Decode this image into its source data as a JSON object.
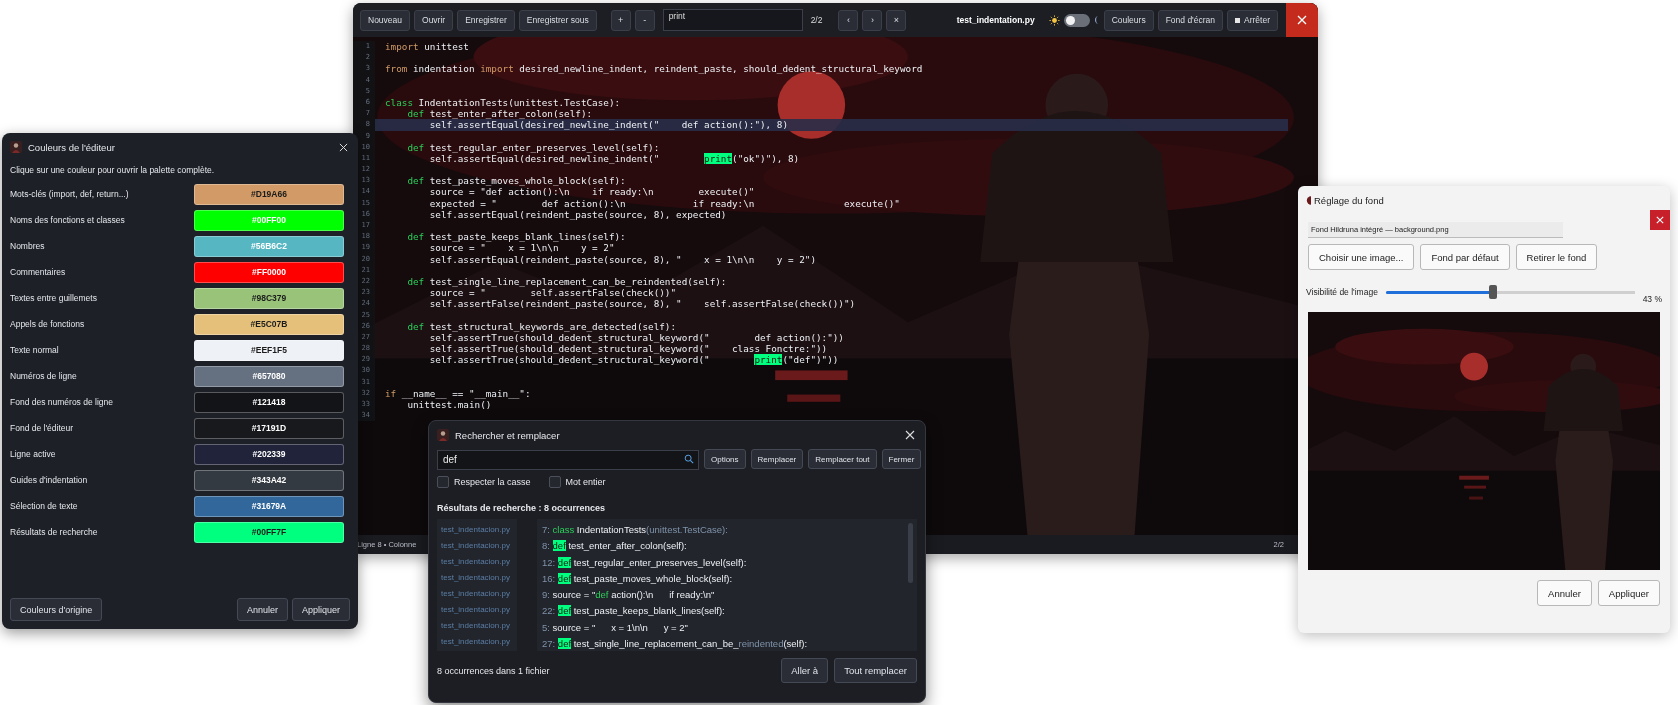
{
  "editor": {
    "toolbar": {
      "file_buttons": [
        "Nouveau",
        "Ouvrir",
        "Enregistrer",
        "Enregistrer sous"
      ],
      "zoom_buttons": [
        "+",
        "-"
      ],
      "search": {
        "value": "print"
      },
      "match_count": "2/2",
      "nav_buttons": [
        "‹",
        "›",
        "×"
      ],
      "filename": "test_indentation.py",
      "theme_toggle": {
        "on": false
      },
      "buttons": [
        {
          "label": "Couleurs",
          "kind": "plain"
        },
        {
          "label": "Fond d'écran",
          "kind": "plain"
        },
        {
          "label": "Arrêter",
          "kind": "stop"
        }
      ]
    },
    "code_lines": [
      {
        "number": "1",
        "active": false,
        "segments": [
          {
            "kind": "keyword",
            "text": "import"
          },
          {
            "kind": "plain",
            "text": " unittest"
          }
        ]
      },
      {
        "number": "2",
        "active": false
      },
      {
        "number": "3",
        "active": false,
        "segments": [
          {
            "kind": "keyword",
            "text": "from"
          },
          {
            "kind": "plain",
            "text": " indentation "
          },
          {
            "kind": "keyword",
            "text": "import"
          },
          {
            "kind": "plain",
            "text": " desired_newline_indent, reindent_paste, should_dedent_structural_keyword"
          }
        ]
      },
      {
        "number": "4",
        "active": false
      },
      {
        "number": "5",
        "active": false
      },
      {
        "number": "6",
        "active": false,
        "segments": [
          {
            "kind": "def",
            "text": "class"
          },
          {
            "kind": "plain",
            "text": " IndentationTests(unittest.TestCase):"
          }
        ]
      },
      {
        "number": "7",
        "active": false,
        "segments": [
          {
            "kind": "def",
            "text": "    def"
          },
          {
            "kind": "plain",
            "text": " test_enter_after_colon(self):"
          }
        ]
      },
      {
        "number": "8",
        "active": true,
        "segments": [
          {
            "kind": "plain",
            "text": "        self.assertEqual(desired_newline_indent(\"    def action():\"), 8)"
          }
        ]
      },
      {
        "number": "9",
        "active": false
      },
      {
        "number": "10",
        "active": false,
        "segments": [
          {
            "kind": "def",
            "text": "    def"
          },
          {
            "kind": "plain",
            "text": " test_regular_enter_preserves_level(self):"
          }
        ]
      },
      {
        "number": "11",
        "active": false,
        "segments": [
          {
            "kind": "plain",
            "text": "        self.assertEqual(desired_newline_indent(\"        "
          },
          {
            "kind": "match",
            "text": "print"
          },
          {
            "kind": "plain",
            "text": "(\"ok\")\"), 8)"
          }
        ]
      },
      {
        "number": "12",
        "active": false
      },
      {
        "number": "13",
        "active": false,
        "segments": [
          {
            "kind": "def",
            "text": "    def"
          },
          {
            "kind": "plain",
            "text": " test_paste_moves_whole_block(self):"
          }
        ]
      },
      {
        "number": "14",
        "active": false,
        "segments": [
          {
            "kind": "plain",
            "text": "        source = \"def action():\\n    if ready:\\n        execute()\""
          }
        ]
      },
      {
        "number": "15",
        "active": false,
        "segments": [
          {
            "kind": "plain",
            "text": "        expected = \"        def action():\\n            if ready:\\n                execute()\""
          }
        ]
      },
      {
        "number": "16",
        "active": false,
        "segments": [
          {
            "kind": "plain",
            "text": "        self.assertEqual(reindent_paste(source, 8), expected)"
          }
        ]
      },
      {
        "number": "17",
        "active": false
      },
      {
        "number": "18",
        "active": false,
        "segments": [
          {
            "kind": "def",
            "text": "    def"
          },
          {
            "kind": "plain",
            "text": " test_paste_keeps_blank_lines(self):"
          }
        ]
      },
      {
        "number": "19",
        "active": false,
        "segments": [
          {
            "kind": "plain",
            "text": "        source = \"    x = 1\\n\\n    y = 2\""
          }
        ]
      },
      {
        "number": "20",
        "active": false,
        "segments": [
          {
            "kind": "plain",
            "text": "        self.assertEqual(reindent_paste(source, 8), \"    x = 1\\n\\n    y = 2\")"
          }
        ]
      },
      {
        "number": "21",
        "active": false
      },
      {
        "number": "22",
        "active": false,
        "segments": [
          {
            "kind": "def",
            "text": "    def"
          },
          {
            "kind": "plain",
            "text": " test_single_line_replacement_can_be_reindented(self):"
          }
        ]
      },
      {
        "number": "23",
        "active": false,
        "segments": [
          {
            "kind": "plain",
            "text": "        source = \"        self.assertFalse(check())\""
          }
        ]
      },
      {
        "number": "24",
        "active": false,
        "segments": [
          {
            "kind": "plain",
            "text": "        self.assertFalse(reindent_paste(source, 8), \"    self.assertFalse(check())\")"
          }
        ]
      },
      {
        "number": "25",
        "active": false
      },
      {
        "number": "26",
        "active": false,
        "segments": [
          {
            "kind": "def",
            "text": "    def"
          },
          {
            "kind": "plain",
            "text": " test_structural_keywords_are_detected(self):"
          }
        ]
      },
      {
        "number": "27",
        "active": false,
        "segments": [
          {
            "kind": "plain",
            "text": "        self.assertTrue(should_dedent_structural_keyword(\"        def action():\"))"
          }
        ]
      },
      {
        "number": "28",
        "active": false,
        "segments": [
          {
            "kind": "plain",
            "text": "        self.assertTrue(should_dedent_structural_keyword(\"    class Fonctre:\"))"
          }
        ]
      },
      {
        "number": "29",
        "active": false,
        "segments": [
          {
            "kind": "plain",
            "text": "        self.assertTrue(should_dedent_structural_keyword(\"        "
          },
          {
            "kind": "match",
            "text": "print"
          },
          {
            "kind": "plain",
            "text": "(\"def\")\"))"
          }
        ]
      },
      {
        "number": "30",
        "active": false
      },
      {
        "number": "31",
        "active": false
      },
      {
        "number": "32",
        "active": false,
        "segments": [
          {
            "kind": "keyword",
            "text": "if"
          },
          {
            "kind": "plain",
            "text": " __name__ == \"__main__\":"
          }
        ]
      },
      {
        "number": "33",
        "active": false,
        "segments": [
          {
            "kind": "plain",
            "text": "    unittest.main()"
          }
        ]
      },
      {
        "number": "34",
        "active": false
      }
    ],
    "status": {
      "position": "Ligne 8 • Colonne",
      "page": "2/2"
    }
  },
  "colors_panel": {
    "title": "Couleurs de l'éditeur",
    "hint": "Clique sur une couleur pour ouvrir la palette complète.",
    "rows": [
      {
        "label": "Mots-clés (import, def, return...)",
        "value": "#D19A66",
        "color": "#d19a66"
      },
      {
        "label": "Noms des fonctions et classes",
        "value": "#00FF00",
        "color": "#00ff00"
      },
      {
        "label": "Nombres",
        "value": "#56B6C2",
        "color": "#56b6c2"
      },
      {
        "label": "Commentaires",
        "value": "#FF0000",
        "color": "#ff0000"
      },
      {
        "label": "Textes entre guillemets",
        "value": "#98C379",
        "color": "#98c379"
      },
      {
        "label": "Appels de fonctions",
        "value": "#E5C07B",
        "color": "#e5c07b"
      },
      {
        "label": "Texte normal",
        "value": "#EEF1F5",
        "color": "#eef1f5"
      },
      {
        "label": "Numéros de ligne",
        "value": "#657080",
        "color": "#657080"
      },
      {
        "label": "Fond des numéros de ligne",
        "value": "#121418",
        "color": "#121418"
      },
      {
        "label": "Fond de l'éditeur",
        "value": "#17191D",
        "color": "#17191d"
      },
      {
        "label": "Ligne active",
        "value": "#202339",
        "color": "#202339"
      },
      {
        "label": "Guides d'indentation",
        "value": "#343A42",
        "color": "#343a42"
      },
      {
        "label": "Sélection de texte",
        "value": "#31679A",
        "color": "#31679a"
      },
      {
        "label": "Résultats de recherche",
        "value": "#00FF7F",
        "color": "#00ff7f"
      }
    ],
    "reset_button": "Couleurs d'origine",
    "buttons": [
      "Annuler",
      "Appliquer"
    ]
  },
  "search_dialog": {
    "title": "Rechercher et remplacer",
    "search": {
      "value": "def"
    },
    "buttons": [
      "Options",
      "Remplacer",
      "Remplacer tout",
      "Fermer"
    ],
    "options": [
      {
        "label": "Respecter la casse",
        "checked": false
      },
      {
        "label": "Mot entier",
        "checked": false
      }
    ],
    "results_heading": "Résultats de recherche : 8 occurrences",
    "files": [
      "test_indentacion.py",
      "test_indentacion.py",
      "test_indentacion.py",
      "test_indentacion.py",
      "test_indentacion.py",
      "test_indentacion.py",
      "test_indentacion.py",
      "test_indentacion.py"
    ],
    "results": [
      {
        "line": "7:",
        "segments": [
          {
            "kind": "def",
            "text": "class"
          },
          {
            "kind": "plain",
            "text": " IndentationTests"
          },
          {
            "kind": "dim",
            "text": "(unittest.TestCase):"
          }
        ]
      },
      {
        "line": "8:",
        "segments": [
          {
            "kind": "match",
            "text": "def"
          },
          {
            "kind": "plain",
            "text": " test_enter_after_colon(self):"
          }
        ]
      },
      {
        "line": "12:",
        "segments": [
          {
            "kind": "match",
            "text": "def"
          },
          {
            "kind": "plain",
            "text": " test_regular_enter_preserves_level(self):"
          }
        ]
      },
      {
        "line": "16:",
        "segments": [
          {
            "kind": "match",
            "text": "def"
          },
          {
            "kind": "plain",
            "text": " test_paste_moves_whole_block(self):"
          }
        ]
      },
      {
        "line": "9:",
        "segments": [
          {
            "kind": "plain",
            "text": "source = \""
          },
          {
            "kind": "def",
            "text": "def"
          },
          {
            "kind": "plain",
            "text": " action():\\n      if ready:\\n\""
          }
        ]
      },
      {
        "line": "22:",
        "segments": [
          {
            "kind": "match",
            "text": "def"
          },
          {
            "kind": "plain",
            "text": " test_paste_keeps_blank_lines(self):"
          }
        ]
      },
      {
        "line": "5:",
        "segments": [
          {
            "kind": "plain",
            "text": "source = \"      x = 1\\n\\n      y = 2\""
          }
        ]
      },
      {
        "line": "27:",
        "segments": [
          {
            "kind": "match",
            "text": "def"
          },
          {
            "kind": "plain",
            "text": " test_single_line_replacement_can_be_"
          },
          {
            "kind": "dim",
            "text": "reindented"
          },
          {
            "kind": "plain",
            "text": "(self):"
          }
        ]
      }
    ],
    "summary": "8 occurrences dans 1 fichier",
    "footer_buttons": [
      "Aller à",
      "Tout remplacer"
    ]
  },
  "background_panel": {
    "title": "Réglage du fond",
    "path": {
      "value": "Fond Hildruna intégré — background.png"
    },
    "buttons": [
      "Choisir une image...",
      "Fond par défaut",
      "Retirer le fond"
    ],
    "visibility": {
      "label": "Visibilité de l'image",
      "level": 0.43,
      "reading": "43 %"
    },
    "preview": {
      "kind": "picture"
    },
    "footer_buttons": [
      "Annuler",
      "Appliquer"
    ]
  }
}
